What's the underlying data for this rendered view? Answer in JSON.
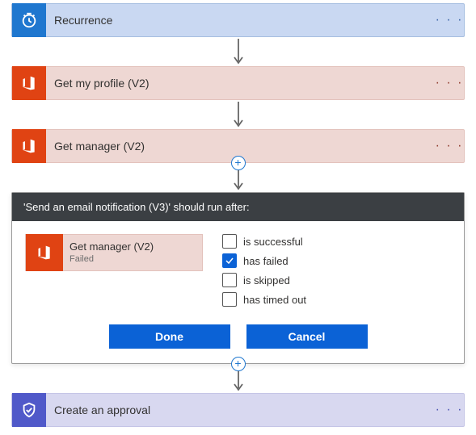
{
  "steps": {
    "recurrence": {
      "title": "Recurrence"
    },
    "profile": {
      "title": "Get my profile (V2)"
    },
    "manager": {
      "title": "Get manager (V2)"
    },
    "approval": {
      "title": "Create an approval"
    }
  },
  "panel": {
    "header": "'Send an email notification (V3)' should run after:",
    "dependency": {
      "title": "Get manager (V2)",
      "status": "Failed"
    },
    "conditions": [
      {
        "label": "is successful",
        "checked": false
      },
      {
        "label": "has failed",
        "checked": true
      },
      {
        "label": "is skipped",
        "checked": false
      },
      {
        "label": "has timed out",
        "checked": false
      }
    ],
    "actions": {
      "done": "Done",
      "cancel": "Cancel"
    }
  },
  "glyphs": {
    "dots": "· · ·",
    "plus": "+"
  }
}
